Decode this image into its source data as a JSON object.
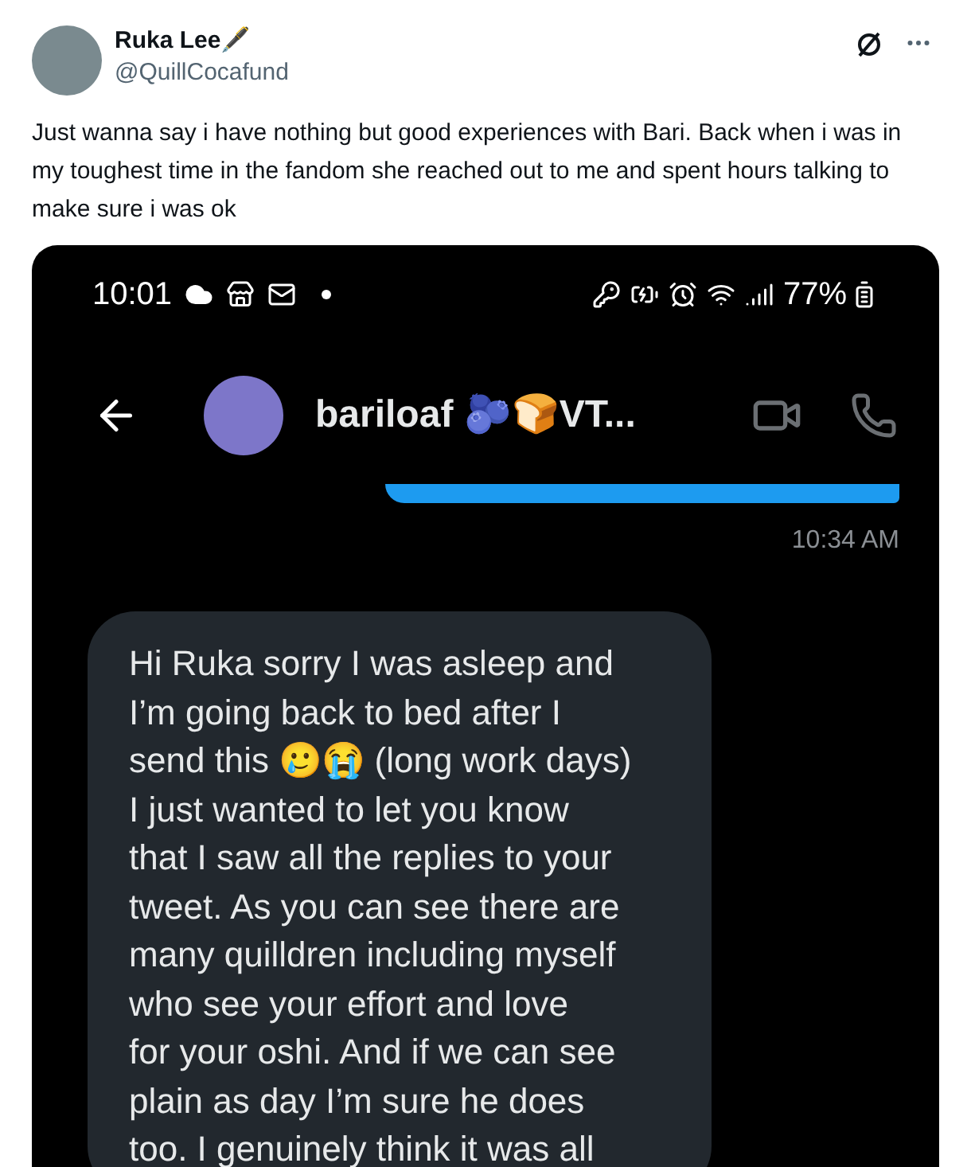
{
  "tweet": {
    "author": {
      "name": "Ruka Lee🖋️",
      "handle": "@QuillCocafund"
    },
    "text": "Just wanna say i have nothing but good experiences with Bari. Back when i was in my toughest time in the fandom she reached out to me and spent hours talking to make sure i was ok",
    "media": {
      "status_bar": {
        "time": "10:01",
        "battery": "77%"
      },
      "chat_header": {
        "contact_name": "bariloaf 🫐🍞VT..."
      },
      "messages": [
        {
          "kind": "sent",
          "time": "10:34 AM"
        },
        {
          "kind": "received",
          "lines": [
            "Hi Ruka sorry I was asleep and",
            "I’m going back to bed after I",
            "send this 🥲😭 (long work days)",
            "I just wanted to let you know",
            "that I saw all the replies to your",
            "tweet. As you can see there are",
            "many quilldren including myself",
            "who see your effort and love",
            "for your oshi. And if we can see",
            "plain as day I’m sure he does",
            "too. I genuinely think it was all"
          ]
        }
      ]
    }
  }
}
